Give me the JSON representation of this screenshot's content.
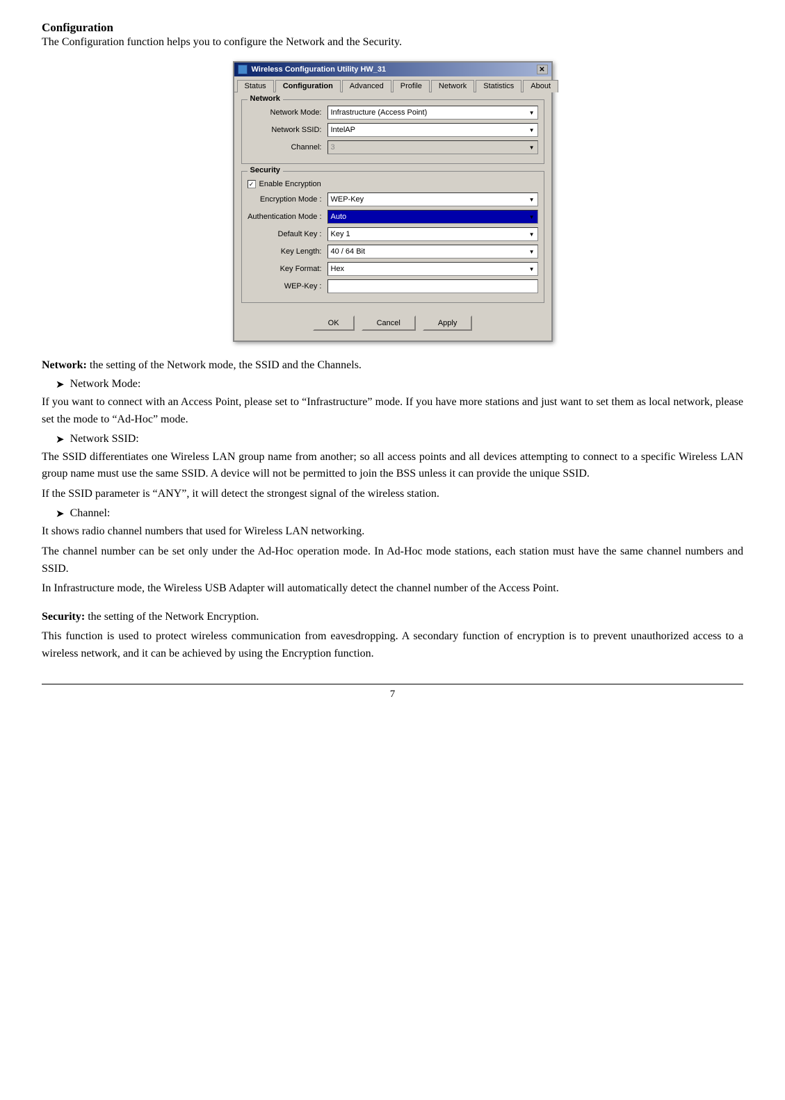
{
  "page": {
    "title": "Configuration",
    "intro": "The Configuration function helps you to configure the Network and the Security."
  },
  "dialog": {
    "title": "Wireless Configuration Utility HW_31",
    "close_btn": "✕",
    "tabs": [
      {
        "label": "Status",
        "active": false
      },
      {
        "label": "Configuration",
        "active": true
      },
      {
        "label": "Advanced",
        "active": false
      },
      {
        "label": "Profile",
        "active": false
      },
      {
        "label": "Network",
        "active": false
      },
      {
        "label": "Statistics",
        "active": false
      },
      {
        "label": "About",
        "active": false
      }
    ],
    "network_group": "Network",
    "network_fields": [
      {
        "label": "Network Mode:",
        "value": "Infrastructure (Access Point)",
        "dropdown": true,
        "disabled": false
      },
      {
        "label": "Network SSID:",
        "value": "IntelAP",
        "dropdown": true,
        "disabled": false
      },
      {
        "label": "Channel:",
        "value": "3",
        "dropdown": true,
        "disabled": true
      }
    ],
    "security_group": "Security",
    "enable_encryption_label": "Enable Encryption",
    "enable_encryption_checked": true,
    "security_fields": [
      {
        "label": "Encryption Mode :",
        "value": "WEP-Key",
        "dropdown": true,
        "highlighted": false
      },
      {
        "label": "Authentication Mode :",
        "value": "Auto",
        "dropdown": true,
        "highlighted": true
      },
      {
        "label": "Default Key :",
        "value": "Key 1",
        "dropdown": true,
        "highlighted": false
      },
      {
        "label": "Key Length:",
        "value": "40 / 64 Bit",
        "dropdown": true,
        "highlighted": false
      },
      {
        "label": "Key Format:",
        "value": "Hex",
        "dropdown": true,
        "highlighted": false
      },
      {
        "label": "WEP-Key :",
        "value": "",
        "dropdown": false,
        "highlighted": false
      }
    ],
    "buttons": [
      {
        "label": "OK"
      },
      {
        "label": "Cancel"
      },
      {
        "label": "Apply"
      }
    ]
  },
  "content": {
    "network_heading": "Network:",
    "network_desc": "the setting of the Network mode, the SSID and the Channels.",
    "bullet1_label": "Network Mode:",
    "bullet1_para": "If you want to connect with an Access Point, please set to “Infrastructure” mode. If you have more stations and just want to set them as local network, please set the mode to “Ad-Hoc” mode.",
    "bullet2_label": "Network SSID:",
    "bullet2_para1": "The SSID differentiates one Wireless LAN group name from another; so all access points and all devices attempting to connect to a specific Wireless LAN group name must use the same SSID. A device will not be permitted to join the BSS unless it can provide the unique SSID.",
    "bullet2_para2": "If the SSID parameter is “ANY”, it will detect the strongest signal of the wireless station.",
    "bullet3_label": "Channel:",
    "bullet3_para1": "It shows radio channel numbers that used for Wireless LAN networking.",
    "bullet3_para2": "The channel number can be set only under the Ad-Hoc operation mode. In Ad-Hoc mode stations, each station must have the same channel numbers and SSID.",
    "bullet3_para3": "In Infrastructure mode, the Wireless USB Adapter will automatically detect the channel number of the Access Point.",
    "security_heading": "Security:",
    "security_desc": "the setting of the Network Encryption.",
    "security_para": "This function is used to protect wireless communication from eavesdropping. A secondary function of encryption is to prevent unauthorized access to a wireless network, and it can be achieved by using the Encryption function.",
    "page_number": "7"
  }
}
